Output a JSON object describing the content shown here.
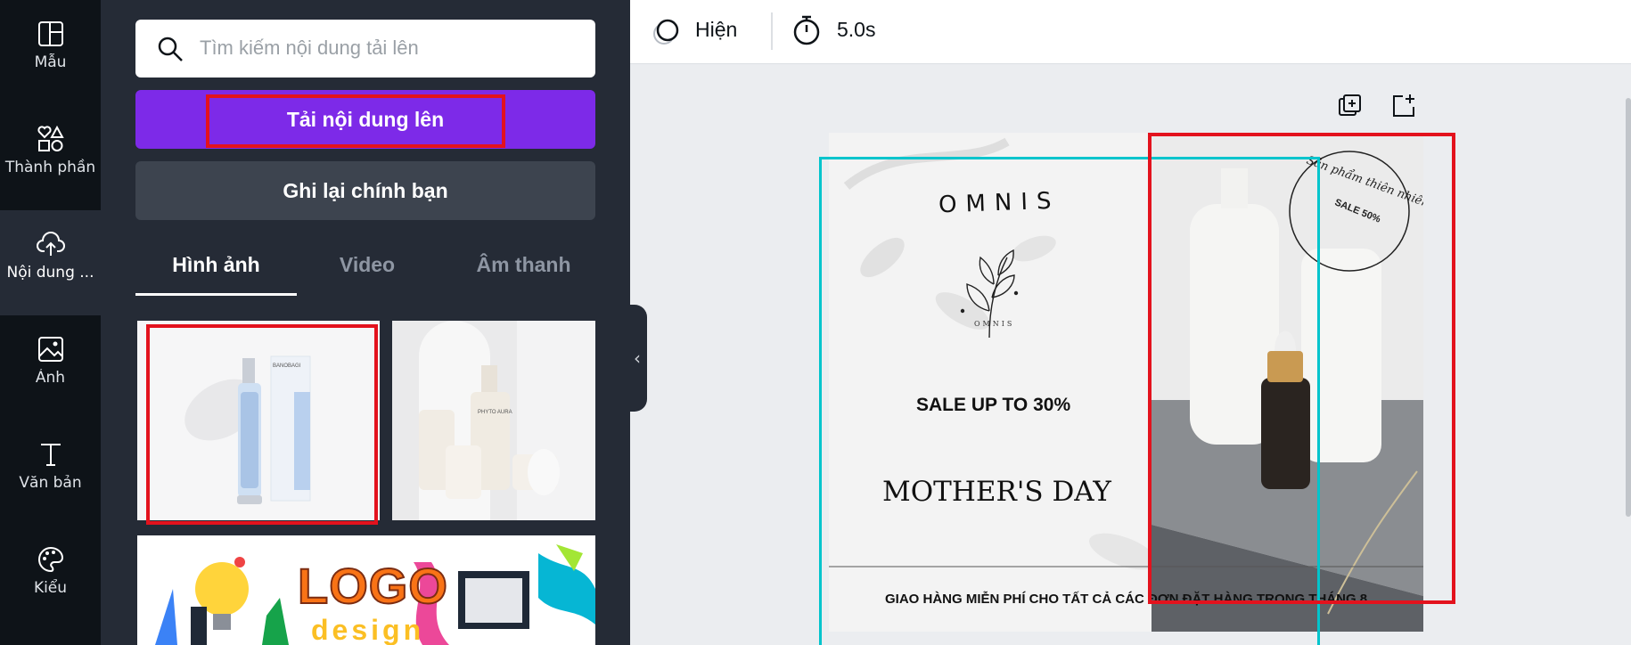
{
  "rail": {
    "items": [
      {
        "label": "Mẫu",
        "icon": "template-icon"
      },
      {
        "label": "Thành phần",
        "icon": "elements-icon"
      },
      {
        "label": "Nội dung ...",
        "icon": "upload-cloud-icon"
      },
      {
        "label": "Ảnh",
        "icon": "photo-icon"
      },
      {
        "label": "Văn bản",
        "icon": "text-icon"
      },
      {
        "label": "Kiểu",
        "icon": "palette-icon"
      }
    ]
  },
  "panel": {
    "search_placeholder": "Tìm kiếm nội dung tải lên",
    "upload_label": "Tải nội dung lên",
    "record_label": "Ghi lại chính bạn",
    "tabs": [
      {
        "label": "Hình ảnh",
        "active": true
      },
      {
        "label": "Video",
        "active": false
      },
      {
        "label": "Âm thanh",
        "active": false
      }
    ]
  },
  "topbar": {
    "animate_label": "Hiện",
    "duration_label": "5.0s"
  },
  "design": {
    "brand": "OMNIS",
    "brand_small": "OMNIS",
    "sale_line": "SALE UP TO 30%",
    "headline": "MOTHER'S DAY",
    "footer": "GIAO HÀNG MIỄN PHÍ CHO TẤT CẢ CÁC ĐƠN ĐẶT HÀNG TRONG THÁNG 8",
    "stamp_arc": "Sản phẩm thiên nhiên",
    "stamp_center": "SALE 50%"
  },
  "thumbs": {
    "t1_brand": "BANOBAGI",
    "t2_brand": "PHYTO AURA",
    "t3_logo": "LOGO",
    "t3_sub": "design"
  },
  "colors": {
    "accent": "#7d2ae8",
    "highlight": "#e3121d",
    "selection": "#00c4cc"
  }
}
